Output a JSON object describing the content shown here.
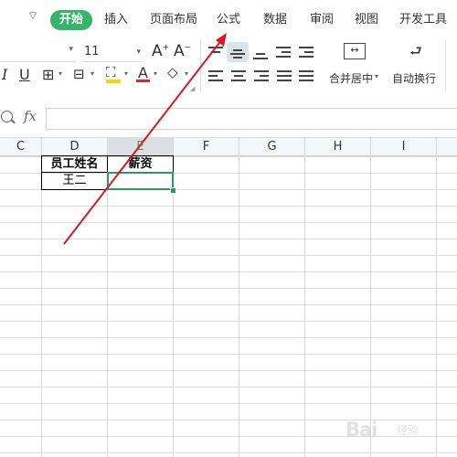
{
  "menu": {
    "tabs": [
      {
        "label": "开始",
        "active": true
      },
      {
        "label": "插入"
      },
      {
        "label": "页面布局"
      },
      {
        "label": "公式"
      },
      {
        "label": "数据"
      },
      {
        "label": "审阅"
      },
      {
        "label": "视图"
      },
      {
        "label": "开发工具"
      }
    ]
  },
  "toolbar": {
    "font_size": "11",
    "merge_label": "合并居中",
    "wrap_label": "自动换行",
    "accent_color": "#35b56a",
    "font_color_bar": "#e0262b",
    "highlight_color_bar": "#f5d800"
  },
  "formula_bar": {
    "fx_label": "fx",
    "value": ""
  },
  "columns": [
    "C",
    "D",
    "E",
    "F",
    "G",
    "H",
    "I"
  ],
  "selected_column": "E",
  "cells": {
    "d1": "员工姓名",
    "e1": "薪资",
    "d2": "王二"
  },
  "watermark": {
    "text": "Bai",
    "sub": "经验"
  }
}
